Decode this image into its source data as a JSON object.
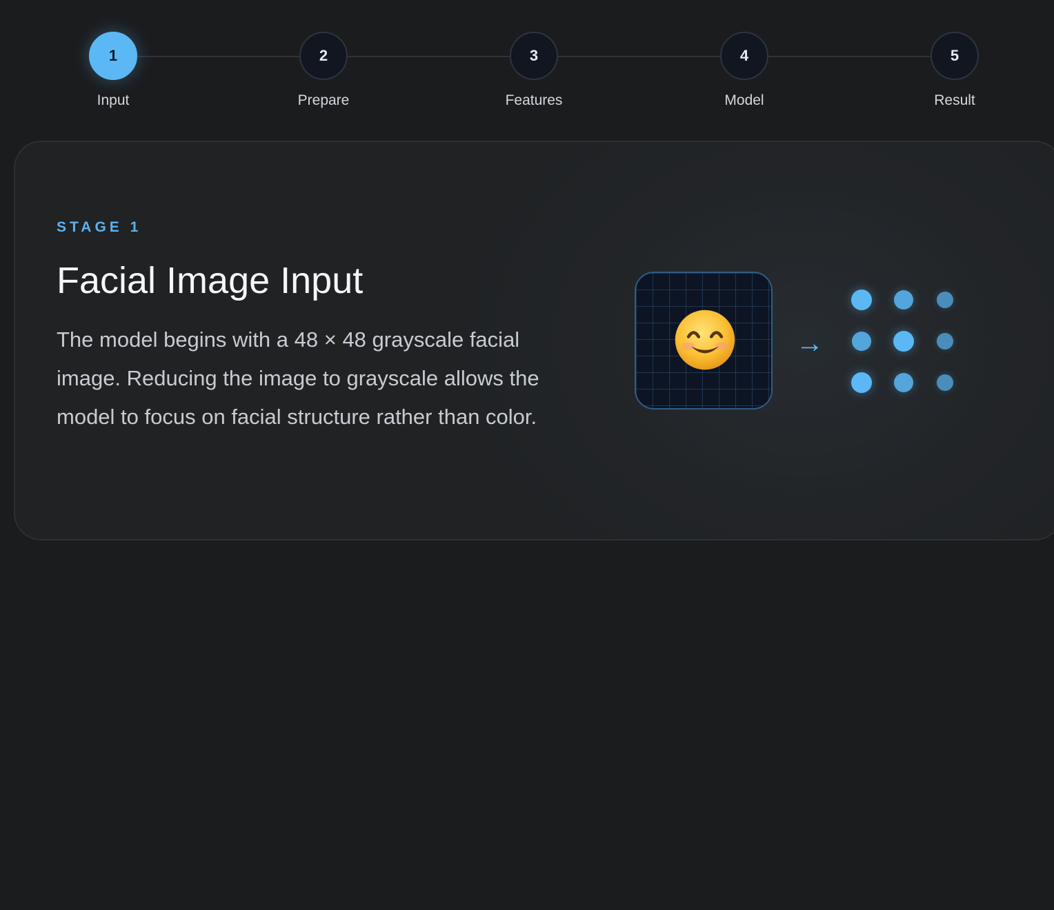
{
  "stepper": {
    "steps": [
      {
        "number": "1",
        "label": "Input",
        "active": true
      },
      {
        "number": "2",
        "label": "Prepare",
        "active": false
      },
      {
        "number": "3",
        "label": "Features",
        "active": false
      },
      {
        "number": "4",
        "label": "Model",
        "active": false
      },
      {
        "number": "5",
        "label": "Result",
        "active": false
      }
    ]
  },
  "stage": {
    "eyebrow": "STAGE 1",
    "title": "Facial Image Input",
    "description": "The model begins with a 48 × 48 grayscale facial image. Reducing the image to grayscale allows the model to focus on facial structure rather than color."
  },
  "visual": {
    "face_icon": "smiling-face-icon",
    "arrow": "→",
    "arrow_icon": "arrow-right-icon",
    "dot_grid_icon": "feature-dots-icon"
  },
  "colors": {
    "accent": "#5bb8f5",
    "background": "#1b1c1e",
    "card": "#222528",
    "tile_border": "#2f5c86"
  }
}
